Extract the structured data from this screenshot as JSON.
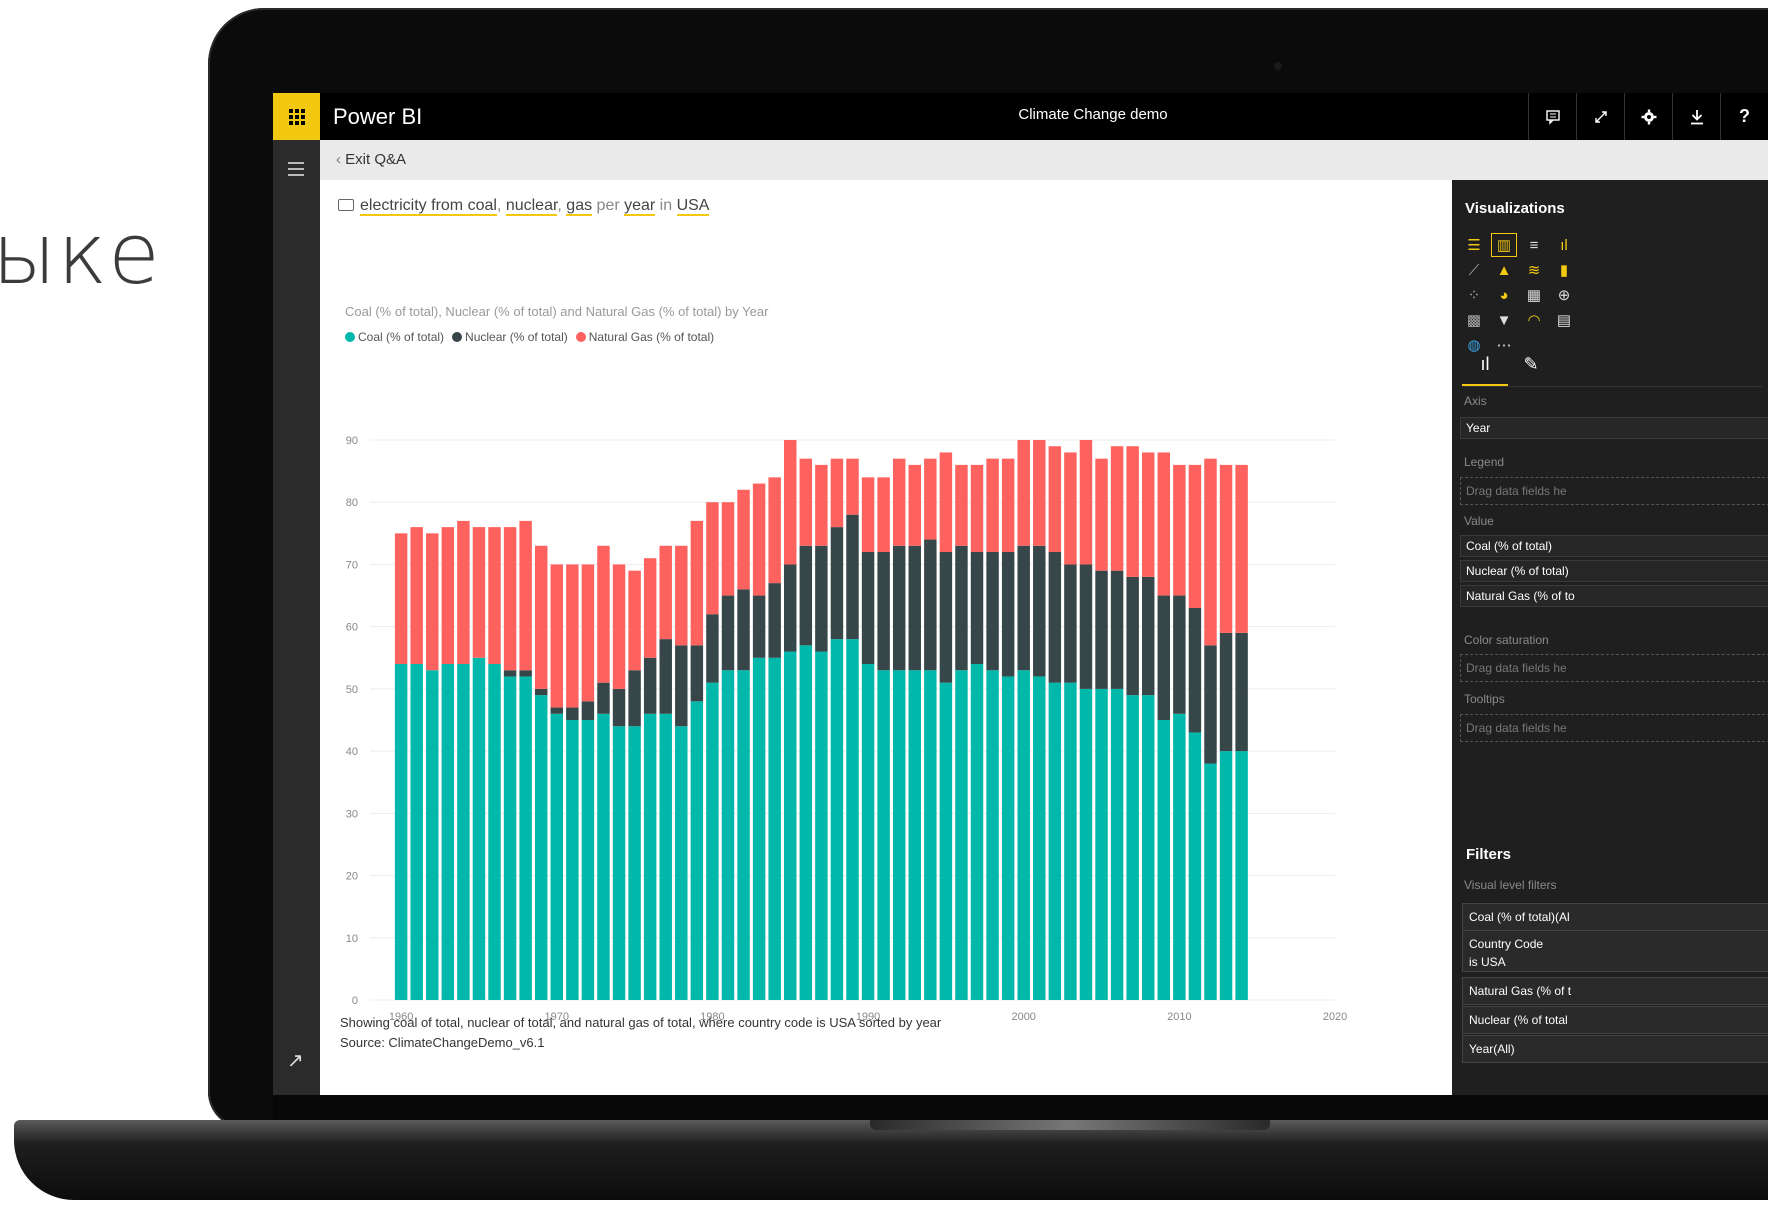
{
  "background_text": "ыке",
  "app": {
    "brand": "Power BI",
    "title": "Climate Change demo"
  },
  "toolbar_icons": [
    "comment-icon",
    "fullscreen-icon",
    "settings-icon",
    "download-icon",
    "help-icon"
  ],
  "subbar": {
    "exit_label": "Exit Q&A"
  },
  "qa": {
    "parts": [
      "electricity from coal",
      ", ",
      "nuclear",
      ", ",
      "gas",
      " per ",
      "year",
      " in ",
      "USA"
    ]
  },
  "chart_data": {
    "type": "bar",
    "stacked": true,
    "title": "Coal (% of total), Nuclear (% of total) and Natural Gas (% of total) by Year",
    "legend_position": "top-left",
    "x": [
      1960,
      1961,
      1962,
      1963,
      1964,
      1965,
      1966,
      1967,
      1968,
      1969,
      1970,
      1971,
      1972,
      1973,
      1974,
      1975,
      1976,
      1977,
      1978,
      1979,
      1980,
      1981,
      1982,
      1983,
      1984,
      1985,
      1986,
      1987,
      1988,
      1989,
      1990,
      1991,
      1992,
      1993,
      1994,
      1995,
      1996,
      1997,
      1998,
      1999,
      2000,
      2001,
      2002,
      2003,
      2004,
      2005,
      2006,
      2007,
      2008,
      2009,
      2010,
      2011,
      2012,
      2013,
      2014
    ],
    "xlim": [
      1958,
      2020
    ],
    "xticks": [
      1960,
      1970,
      1980,
      1990,
      2000,
      2010,
      2020
    ],
    "ylim": [
      0,
      90
    ],
    "yticks": [
      0,
      10,
      20,
      30,
      40,
      50,
      60,
      70,
      80,
      90
    ],
    "grid": true,
    "series": [
      {
        "name": "Coal (% of total)",
        "color": "#01b8aa",
        "values": [
          54,
          54,
          53,
          54,
          54,
          55,
          54,
          52,
          52,
          49,
          46,
          45,
          45,
          46,
          44,
          44,
          46,
          46,
          44,
          48,
          51,
          53,
          53,
          55,
          55,
          56,
          57,
          56,
          58,
          58,
          54,
          53,
          53,
          53,
          53,
          51,
          53,
          54,
          53,
          52,
          53,
          52,
          51,
          51,
          50,
          50,
          50,
          49,
          49,
          45,
          46,
          43,
          38,
          40,
          40
        ]
      },
      {
        "name": "Nuclear (% of total)",
        "color": "#374649",
        "values": [
          0,
          0,
          0,
          0,
          0,
          0,
          0,
          1,
          1,
          1,
          1,
          2,
          3,
          5,
          6,
          9,
          9,
          12,
          13,
          9,
          11,
          12,
          13,
          10,
          12,
          14,
          16,
          17,
          18,
          20,
          18,
          19,
          20,
          20,
          21,
          21,
          20,
          18,
          19,
          20,
          20,
          21,
          21,
          19,
          20,
          19,
          19,
          19,
          19,
          20,
          19,
          20,
          19,
          19,
          19
        ]
      },
      {
        "name": "Natural Gas (% of total)",
        "color": "#fd625e",
        "values": [
          21,
          22,
          22,
          22,
          23,
          21,
          22,
          23,
          24,
          23,
          23,
          23,
          22,
          22,
          20,
          16,
          16,
          15,
          16,
          20,
          18,
          15,
          16,
          18,
          17,
          20,
          14,
          13,
          11,
          9,
          12,
          12,
          14,
          13,
          13,
          16,
          13,
          14,
          15,
          15,
          17,
          17,
          17,
          18,
          20,
          18,
          20,
          21,
          20,
          23,
          21,
          23,
          30,
          27,
          27
        ]
      }
    ]
  },
  "footer": {
    "showing": "Showing coal of total, nuclear of total, and natural gas of total, where country code is USA sorted by year",
    "source": "Source: ClimateChangeDemo_v6.1"
  },
  "viz_pane": {
    "title": "Visualizations",
    "wells": {
      "axis_label": "Axis",
      "axis_value": "Year",
      "legend_label": "Legend",
      "legend_placeholder": "Drag data fields he",
      "value_label": "Value",
      "values": [
        "Coal (% of total)",
        "Nuclear (% of total)",
        "Natural Gas (% of to"
      ],
      "color_label": "Color saturation",
      "color_placeholder": "Drag data fields he",
      "tooltips_label": "Tooltips",
      "tooltips_placeholder": "Drag data fields he"
    },
    "filters": {
      "title": "Filters",
      "level_label": "Visual level filters",
      "items": [
        "Coal (% of total)(Al",
        "Country Code",
        "is USA",
        "Natural Gas (% of t",
        "Nuclear (% of total",
        "Year(All)"
      ]
    }
  }
}
